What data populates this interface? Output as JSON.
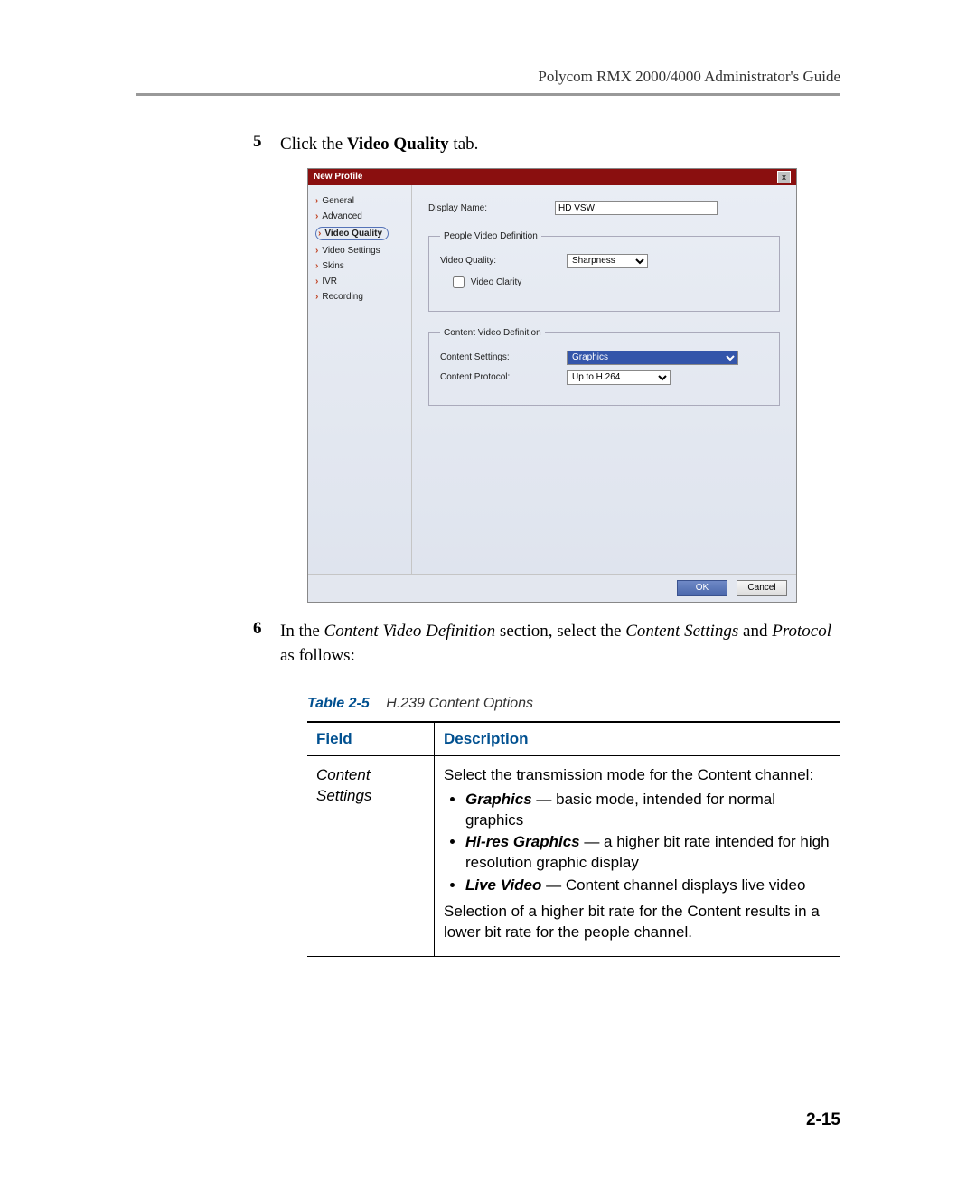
{
  "header": {
    "guide": "Polycom RMX 2000/4000 Administrator's Guide"
  },
  "steps": {
    "s5": {
      "num": "5",
      "pre": "Click the ",
      "bold": "Video Quality",
      "post": " tab."
    },
    "s6": {
      "num": "6",
      "t1": "In the ",
      "i1": "Content Video Definition",
      "t2": " section, select the ",
      "i2": "Content Settings",
      "t3": " and ",
      "i3": "Protocol",
      "t4": " as follows:"
    }
  },
  "shot": {
    "title": "New Profile",
    "close": "x",
    "nav": {
      "general": "General",
      "advanced": "Advanced",
      "videoQuality": "Video Quality",
      "videoSettings": "Video Settings",
      "skins": "Skins",
      "ivr": "IVR",
      "recording": "Recording"
    },
    "form": {
      "displayNameLabel": "Display Name:",
      "displayNameValue": "HD VSW",
      "group1": "People Video Definition",
      "videoQualityLabel": "Video Quality:",
      "videoQualityValue": "Sharpness",
      "videoClarityLabel": "Video Clarity",
      "group2": "Content Video Definition",
      "contentSettingsLabel": "Content Settings:",
      "contentSettingsValue": "Graphics",
      "contentProtocolLabel": "Content Protocol:",
      "contentProtocolValue": "Up to H.264"
    },
    "buttons": {
      "ok": "OK",
      "cancel": "Cancel"
    }
  },
  "tableCaption": {
    "num": "Table 2-5",
    "title": "H.239 Content Options"
  },
  "table": {
    "headField": "Field",
    "headDesc": "Description",
    "row1Field": "Content Settings",
    "row1": {
      "intro": "Select the transmission mode for the Content channel:",
      "b1": "Graphics",
      "b1t": " — basic mode, intended for normal graphics",
      "b2": "Hi-res Graphics",
      "b2t": " — a higher bit rate intended for high resolution graphic display",
      "b3": "Live Video",
      "b3t": " — Content channel displays live video",
      "outro": "Selection of a higher bit rate for the Content results in a lower bit rate for the people channel."
    }
  },
  "pageNum": "2-15"
}
